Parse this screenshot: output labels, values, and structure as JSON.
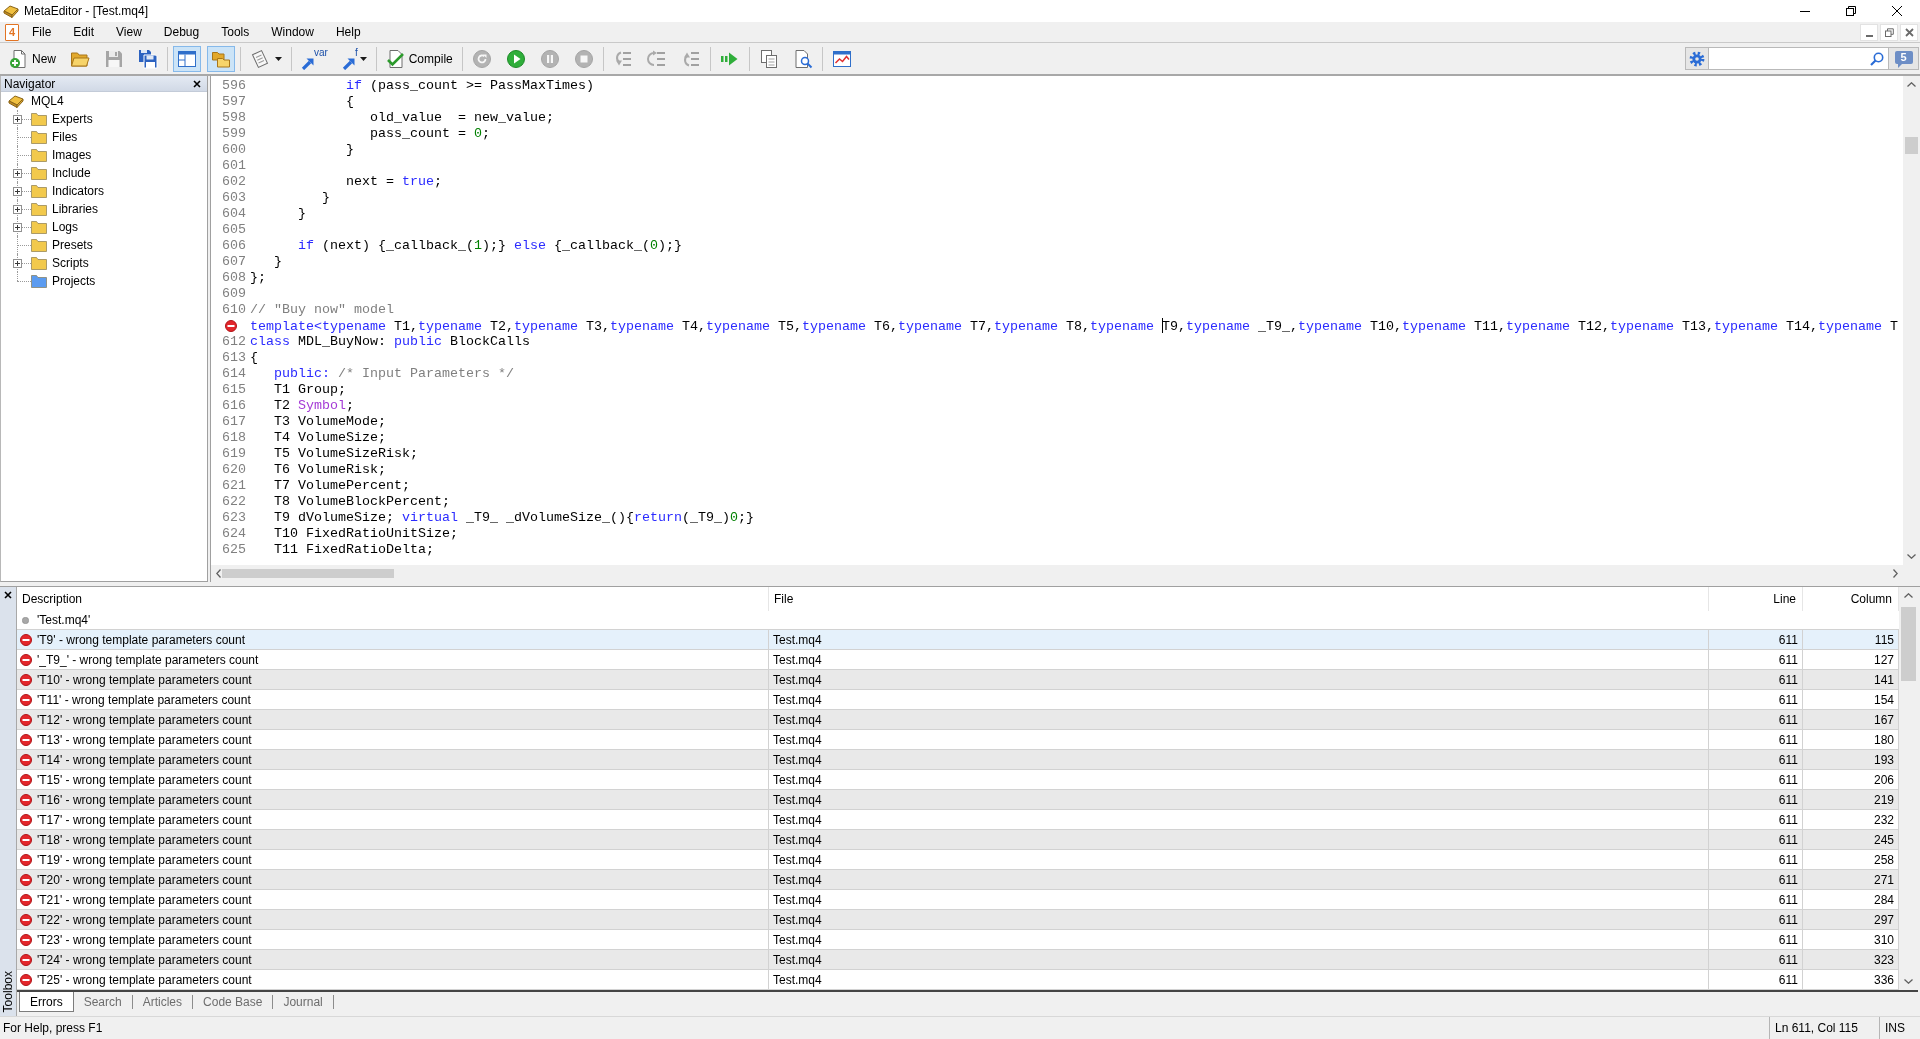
{
  "window": {
    "title": "MetaEditor - [Test.mq4]"
  },
  "menu_bar": {
    "document_badge": "4",
    "items": [
      "File",
      "Edit",
      "View",
      "Debug",
      "Tools",
      "Window",
      "Help"
    ]
  },
  "toolbar": {
    "groups": [
      [
        {
          "kind": "text",
          "label": "New",
          "pressed": false,
          "disabled": false,
          "dropdown": false
        },
        {
          "kind": "icon",
          "pressed": false,
          "disabled": false,
          "dropdown": false
        },
        {
          "kind": "icon",
          "pressed": false,
          "disabled": true,
          "dropdown": false
        },
        {
          "kind": "icon",
          "pressed": false,
          "disabled": false,
          "dropdown": false
        }
      ],
      [
        {
          "kind": "icon",
          "pressed": true,
          "disabled": false,
          "dropdown": false
        },
        {
          "kind": "icon",
          "pressed": true,
          "disabled": false,
          "dropdown": false
        }
      ],
      [
        {
          "kind": "icon",
          "pressed": false,
          "disabled": false,
          "dropdown": true
        }
      ],
      [
        {
          "kind": "icon-label",
          "label": "var",
          "pressed": false,
          "disabled": false,
          "dropdown": false
        },
        {
          "kind": "icon-label",
          "label": "f",
          "pressed": false,
          "disabled": false,
          "dropdown": true
        }
      ],
      [
        {
          "kind": "text",
          "label": "Compile",
          "pressed": false,
          "disabled": false,
          "dropdown": false
        }
      ],
      [
        {
          "kind": "icon",
          "pressed": false,
          "disabled": true,
          "dropdown": false
        },
        {
          "kind": "icon",
          "pressed": false,
          "disabled": false,
          "dropdown": false
        },
        {
          "kind": "icon",
          "pressed": false,
          "disabled": true,
          "dropdown": false
        },
        {
          "kind": "icon",
          "pressed": false,
          "disabled": true,
          "dropdown": false
        }
      ],
      [
        {
          "kind": "icon",
          "pressed": false,
          "disabled": true,
          "dropdown": false
        },
        {
          "kind": "icon",
          "pressed": false,
          "disabled": true,
          "dropdown": false
        },
        {
          "kind": "icon",
          "pressed": false,
          "disabled": true,
          "dropdown": false
        }
      ],
      [
        {
          "kind": "icon",
          "pressed": false,
          "disabled": false,
          "dropdown": false
        }
      ],
      [
        {
          "kind": "icon",
          "pressed": false,
          "disabled": false,
          "dropdown": false
        },
        {
          "kind": "icon",
          "pressed": false,
          "disabled": false,
          "dropdown": false
        }
      ],
      [
        {
          "kind": "icon",
          "pressed": false,
          "disabled": false,
          "dropdown": false
        }
      ]
    ],
    "messages_count": "5"
  },
  "navigator": {
    "title": "Navigator",
    "tree": {
      "label": "MQL4",
      "children": [
        {
          "label": "Experts",
          "expandable": true,
          "color": "#f2c94c"
        },
        {
          "label": "Files",
          "expandable": false,
          "color": "#f2c94c"
        },
        {
          "label": "Images",
          "expandable": false,
          "color": "#f2c94c"
        },
        {
          "label": "Include",
          "expandable": true,
          "color": "#f2c94c"
        },
        {
          "label": "Indicators",
          "expandable": true,
          "color": "#f2c94c"
        },
        {
          "label": "Libraries",
          "expandable": true,
          "color": "#f2c94c"
        },
        {
          "label": "Logs",
          "expandable": true,
          "color": "#f2c94c"
        },
        {
          "label": "Presets",
          "expandable": false,
          "color": "#f2c94c"
        },
        {
          "label": "Scripts",
          "expandable": true,
          "color": "#f2c94c"
        },
        {
          "label": "Projects",
          "expandable": false,
          "color": "#5b9bf0"
        }
      ]
    }
  },
  "editor": {
    "lines": [
      {
        "number": "596",
        "error": false,
        "tokens": [
          {
            "text": "            if",
            "kind": "keyword"
          },
          {
            "text": " (pass_count >= PassMaxTimes)",
            "kind": "plain"
          }
        ]
      },
      {
        "number": "597",
        "error": false,
        "tokens": [
          {
            "text": "            {",
            "kind": "plain"
          }
        ]
      },
      {
        "number": "598",
        "error": false,
        "tokens": [
          {
            "text": "               old_value  = new_value;",
            "kind": "plain"
          }
        ]
      },
      {
        "number": "599",
        "error": false,
        "tokens": [
          {
            "text": "               pass_count = ",
            "kind": "plain"
          },
          {
            "text": "0",
            "kind": "number"
          },
          {
            "text": ";",
            "kind": "plain"
          }
        ]
      },
      {
        "number": "600",
        "error": false,
        "tokens": [
          {
            "text": "            }",
            "kind": "plain"
          }
        ]
      },
      {
        "number": "601",
        "error": false
      },
      {
        "number": "602",
        "error": false,
        "tokens": [
          {
            "text": "            next = ",
            "kind": "plain"
          },
          {
            "text": "true",
            "kind": "keyword"
          },
          {
            "text": ";",
            "kind": "plain"
          }
        ]
      },
      {
        "number": "603",
        "error": false,
        "tokens": [
          {
            "text": "         }",
            "kind": "plain"
          }
        ]
      },
      {
        "number": "604",
        "error": false,
        "tokens": [
          {
            "text": "      }",
            "kind": "plain"
          }
        ]
      },
      {
        "number": "605",
        "error": false
      },
      {
        "number": "606",
        "error": false,
        "tokens": [
          {
            "text": "      if",
            "kind": "keyword"
          },
          {
            "text": " (next) {_callback_(",
            "kind": "plain"
          },
          {
            "text": "1",
            "kind": "number"
          },
          {
            "text": ");} ",
            "kind": "plain"
          },
          {
            "text": "else",
            "kind": "keyword"
          },
          {
            "text": " {_callback_(",
            "kind": "plain"
          },
          {
            "text": "0",
            "kind": "number"
          },
          {
            "text": ");}",
            "kind": "plain"
          }
        ]
      },
      {
        "number": "607",
        "error": false,
        "tokens": [
          {
            "text": "   }",
            "kind": "plain"
          }
        ]
      },
      {
        "number": "608",
        "error": false,
        "tokens": [
          {
            "text": "};",
            "kind": "plain"
          }
        ]
      },
      {
        "number": "609",
        "error": false
      },
      {
        "number": "610",
        "error": false,
        "tokens": [
          {
            "text": "// \"Buy now\" model",
            "kind": "comment"
          }
        ]
      },
      {
        "error": true,
        "tokens": [
          {
            "text": "template<typename",
            "kind": "keyword"
          },
          {
            "text": " T1,",
            "kind": "plain"
          },
          {
            "text": "typename",
            "kind": "keyword"
          },
          {
            "text": " T2,",
            "kind": "plain"
          },
          {
            "text": "typename",
            "kind": "keyword"
          },
          {
            "text": " T3,",
            "kind": "plain"
          },
          {
            "text": "typename",
            "kind": "keyword"
          },
          {
            "text": " T4,",
            "kind": "plain"
          },
          {
            "text": "typename",
            "kind": "keyword"
          },
          {
            "text": " T5,",
            "kind": "plain"
          },
          {
            "text": "typename",
            "kind": "keyword"
          },
          {
            "text": " T6,",
            "kind": "plain"
          },
          {
            "text": "typename",
            "kind": "keyword"
          },
          {
            "text": " T7,",
            "kind": "plain"
          },
          {
            "text": "typename",
            "kind": "keyword"
          },
          {
            "text": " T8,",
            "kind": "plain"
          },
          {
            "text": "typename ",
            "kind": "keyword"
          },
          {
            "kind": "caret"
          },
          {
            "text": "T9,",
            "kind": "plain"
          },
          {
            "text": "typename",
            "kind": "keyword"
          },
          {
            "text": " _T9_,",
            "kind": "plain"
          },
          {
            "text": "typename",
            "kind": "keyword"
          },
          {
            "text": " T10,",
            "kind": "plain"
          },
          {
            "text": "typename",
            "kind": "keyword"
          },
          {
            "text": " T11,",
            "kind": "plain"
          },
          {
            "text": "typename",
            "kind": "keyword"
          },
          {
            "text": " T12,",
            "kind": "plain"
          },
          {
            "text": "typename",
            "kind": "keyword"
          },
          {
            "text": " T13,",
            "kind": "plain"
          },
          {
            "text": "typename",
            "kind": "keyword"
          },
          {
            "text": " T14,",
            "kind": "plain"
          },
          {
            "text": "typename",
            "kind": "keyword"
          },
          {
            "text": " T",
            "kind": "plain"
          }
        ]
      },
      {
        "number": "612",
        "error": false,
        "tokens": [
          {
            "text": "class",
            "kind": "keyword"
          },
          {
            "text": " MDL_BuyNow: ",
            "kind": "plain"
          },
          {
            "text": "public",
            "kind": "keyword"
          },
          {
            "text": " BlockCalls",
            "kind": "plain"
          }
        ]
      },
      {
        "number": "613",
        "error": false,
        "tokens": [
          {
            "text": "{",
            "kind": "plain"
          }
        ]
      },
      {
        "number": "614",
        "error": false,
        "tokens": [
          {
            "text": "   public:",
            "kind": "keyword"
          },
          {
            "text": " /* Input Parameters */",
            "kind": "comment"
          }
        ]
      },
      {
        "number": "615",
        "error": false,
        "tokens": [
          {
            "text": "   T1 Group;",
            "kind": "plain"
          }
        ]
      },
      {
        "number": "616",
        "error": false,
        "tokens": [
          {
            "text": "   T2 ",
            "kind": "plain"
          },
          {
            "text": "Symbol",
            "kind": "builtin"
          },
          {
            "text": ";",
            "kind": "plain"
          }
        ]
      },
      {
        "number": "617",
        "error": false,
        "tokens": [
          {
            "text": "   T3 VolumeMode;",
            "kind": "plain"
          }
        ]
      },
      {
        "number": "618",
        "error": false,
        "tokens": [
          {
            "text": "   T4 VolumeSize;",
            "kind": "plain"
          }
        ]
      },
      {
        "number": "619",
        "error": false,
        "tokens": [
          {
            "text": "   T5 VolumeSizeRisk;",
            "kind": "plain"
          }
        ]
      },
      {
        "number": "620",
        "error": false,
        "tokens": [
          {
            "text": "   T6 VolumeRisk;",
            "kind": "plain"
          }
        ]
      },
      {
        "number": "621",
        "error": false,
        "tokens": [
          {
            "text": "   T7 VolumePercent;",
            "kind": "plain"
          }
        ]
      },
      {
        "number": "622",
        "error": false,
        "tokens": [
          {
            "text": "   T8 VolumeBlockPercent;",
            "kind": "plain"
          }
        ]
      },
      {
        "number": "623",
        "error": false,
        "tokens": [
          {
            "text": "   T9 dVolumeSize; ",
            "kind": "plain"
          },
          {
            "text": "virtual",
            "kind": "keyword"
          },
          {
            "text": " _T9_ _dVolumeSize_(){",
            "kind": "plain"
          },
          {
            "text": "return",
            "kind": "keyword"
          },
          {
            "text": "(_T9_)",
            "kind": "plain"
          },
          {
            "text": "0",
            "kind": "number"
          },
          {
            "text": ";}",
            "kind": "plain"
          }
        ]
      },
      {
        "number": "624",
        "error": false,
        "tokens": [
          {
            "text": "   T10 FixedRatioUnitSize;",
            "kind": "plain"
          }
        ]
      },
      {
        "number": "625",
        "error": false,
        "tokens": [
          {
            "text": "   T11 FixedRatioDelta;",
            "kind": "plain"
          }
        ]
      }
    ]
  },
  "toolbox": {
    "title": "Toolbox",
    "table": {
      "columns": [
        "Description",
        "File",
        "Line",
        "Column"
      ],
      "group": "'Test.mq4'",
      "rows": [
        {
          "description": "'T9' - wrong template parameters count",
          "file": "Test.mq4",
          "line": "611",
          "column": "115",
          "selected": true
        },
        {
          "description": "'_T9_' - wrong template parameters count",
          "file": "Test.mq4",
          "line": "611",
          "column": "127",
          "selected": false
        },
        {
          "description": "'T10' - wrong template parameters count",
          "file": "Test.mq4",
          "line": "611",
          "column": "141",
          "selected": false
        },
        {
          "description": "'T11' - wrong template parameters count",
          "file": "Test.mq4",
          "line": "611",
          "column": "154",
          "selected": false
        },
        {
          "description": "'T12' - wrong template parameters count",
          "file": "Test.mq4",
          "line": "611",
          "column": "167",
          "selected": false
        },
        {
          "description": "'T13' - wrong template parameters count",
          "file": "Test.mq4",
          "line": "611",
          "column": "180",
          "selected": false
        },
        {
          "description": "'T14' - wrong template parameters count",
          "file": "Test.mq4",
          "line": "611",
          "column": "193",
          "selected": false
        },
        {
          "description": "'T15' - wrong template parameters count",
          "file": "Test.mq4",
          "line": "611",
          "column": "206",
          "selected": false
        },
        {
          "description": "'T16' - wrong template parameters count",
          "file": "Test.mq4",
          "line": "611",
          "column": "219",
          "selected": false
        },
        {
          "description": "'T17' - wrong template parameters count",
          "file": "Test.mq4",
          "line": "611",
          "column": "232",
          "selected": false
        },
        {
          "description": "'T18' - wrong template parameters count",
          "file": "Test.mq4",
          "line": "611",
          "column": "245",
          "selected": false
        },
        {
          "description": "'T19' - wrong template parameters count",
          "file": "Test.mq4",
          "line": "611",
          "column": "258",
          "selected": false
        },
        {
          "description": "'T20' - wrong template parameters count",
          "file": "Test.mq4",
          "line": "611",
          "column": "271",
          "selected": false
        },
        {
          "description": "'T21' - wrong template parameters count",
          "file": "Test.mq4",
          "line": "611",
          "column": "284",
          "selected": false
        },
        {
          "description": "'T22' - wrong template parameters count",
          "file": "Test.mq4",
          "line": "611",
          "column": "297",
          "selected": false
        },
        {
          "description": "'T23' - wrong template parameters count",
          "file": "Test.mq4",
          "line": "611",
          "column": "310",
          "selected": false
        },
        {
          "description": "'T24' - wrong template parameters count",
          "file": "Test.mq4",
          "line": "611",
          "column": "323",
          "selected": false
        },
        {
          "description": "'T25' - wrong template parameters count",
          "file": "Test.mq4",
          "line": "611",
          "column": "336",
          "selected": false
        }
      ]
    },
    "tabs": [
      {
        "label": "Errors",
        "selected": true
      },
      {
        "label": "Search",
        "selected": false
      },
      {
        "label": "Articles",
        "selected": false
      },
      {
        "label": "Code Base",
        "selected": false
      },
      {
        "label": "Journal",
        "selected": false
      }
    ]
  },
  "status_bar": {
    "help": "For Help, press F1",
    "position": "Ln 611, Col 115",
    "mode": "INS"
  }
}
